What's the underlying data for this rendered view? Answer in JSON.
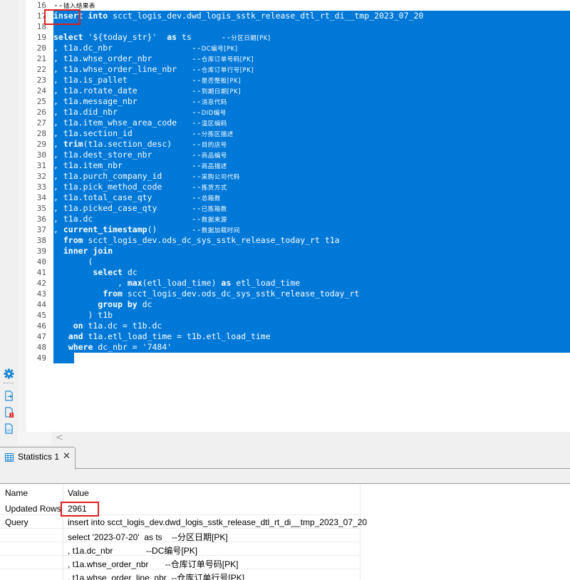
{
  "editor": {
    "lines": [
      {
        "num": "16",
        "selected": false,
        "code": "--",
        "comment": "插入结果表"
      },
      {
        "num": "17",
        "selected": true,
        "code": "insert into scct_logis_dev.dwd_logis_sstk_release_dtl_rt_di__tmp_2023_07_20",
        "comment": ""
      },
      {
        "num": "18",
        "selected": true,
        "code": "",
        "comment": ""
      },
      {
        "num": "19",
        "selected": true,
        "code": "select '${today_str}'  as ts      --",
        "comment": "分区日期[PK]"
      },
      {
        "num": "20",
        "selected": true,
        "code": ", t1a.dc_nbr                --",
        "comment": "DC编号[PK]"
      },
      {
        "num": "21",
        "selected": true,
        "code": ", t1a.whse_order_nbr        --",
        "comment": "仓库订单号码[PK]"
      },
      {
        "num": "22",
        "selected": true,
        "code": ", t1a.whse_order_line_nbr   --",
        "comment": "仓库订单行号[PK]"
      },
      {
        "num": "23",
        "selected": true,
        "code": ", t1a.is_pallet             --",
        "comment": "是否整板[PK]"
      },
      {
        "num": "24",
        "selected": true,
        "code": ", t1a.rotate_date           --",
        "comment": "到期日期[PK]"
      },
      {
        "num": "25",
        "selected": true,
        "code": ", t1a.message_nbr           --",
        "comment": "消息代码"
      },
      {
        "num": "26",
        "selected": true,
        "code": ", t1a.did_nbr               --",
        "comment": "DID编号"
      },
      {
        "num": "27",
        "selected": true,
        "code": ", t1a.item_whse_area_code   --",
        "comment": "温区编码"
      },
      {
        "num": "28",
        "selected": true,
        "code": ", t1a.section_id            --",
        "comment": "分拣区描述"
      },
      {
        "num": "29",
        "selected": true,
        "code": ", trim(t1a.section_desc)    --",
        "comment": "目的店号"
      },
      {
        "num": "30",
        "selected": true,
        "code": ", t1a.dest_store_nbr        --",
        "comment": "商品编号"
      },
      {
        "num": "31",
        "selected": true,
        "code": ", t1a.item_nbr              --",
        "comment": "商品描述"
      },
      {
        "num": "32",
        "selected": true,
        "code": ", t1a.purch_company_id      --",
        "comment": "采购公司代码"
      },
      {
        "num": "33",
        "selected": true,
        "code": ", t1a.pick_method_code      --",
        "comment": "拣货方式"
      },
      {
        "num": "34",
        "selected": true,
        "code": ", t1a.total_case_qty        --",
        "comment": "总箱数"
      },
      {
        "num": "35",
        "selected": true,
        "code": ", t1a.picked_case_qty       --",
        "comment": "已拣箱数"
      },
      {
        "num": "36",
        "selected": true,
        "code": ", t1a.dc                    --",
        "comment": "数据来源"
      },
      {
        "num": "37",
        "selected": true,
        "code": ", current_timestamp()       --",
        "comment": "数据加载时间"
      },
      {
        "num": "38",
        "selected": true,
        "code": "  from scct_logis_dev.ods_dc_sys_sstk_release_today_rt t1a",
        "comment": ""
      },
      {
        "num": "39",
        "selected": true,
        "code": "  inner join",
        "comment": ""
      },
      {
        "num": "40",
        "selected": true,
        "code": "       (",
        "comment": ""
      },
      {
        "num": "41",
        "selected": true,
        "code": "        select dc",
        "comment": ""
      },
      {
        "num": "42",
        "selected": true,
        "code": "             , max(etl_load_time) as etl_load_time",
        "comment": ""
      },
      {
        "num": "43",
        "selected": true,
        "code": "          from scct_logis_dev.ods_dc_sys_sstk_release_today_rt",
        "comment": ""
      },
      {
        "num": "44",
        "selected": true,
        "code": "         group by dc",
        "comment": ""
      },
      {
        "num": "45",
        "selected": true,
        "code": "       ) t1b",
        "comment": ""
      },
      {
        "num": "46",
        "selected": true,
        "code": "    on t1a.dc = t1b.dc",
        "comment": ""
      },
      {
        "num": "47",
        "selected": true,
        "code": "   and t1a.etl_load_time = t1b.etl_load_time",
        "comment": ""
      },
      {
        "num": "48",
        "selected": true,
        "code": "   where dc_nbr = '7484'",
        "comment": ""
      },
      {
        "num": "49",
        "selected": true,
        "code": "    ;",
        "comment": ""
      }
    ],
    "selection_color": "#0078d7",
    "highlight_color": "#e02020"
  },
  "left_rail": {
    "icons": [
      "gear-icon",
      "export-file-icon",
      "file-error-icon",
      "file-variable-icon"
    ]
  },
  "scrollbar": {
    "left_arrow": "<"
  },
  "results": {
    "tab_label": "Statistics 1",
    "tab_close": "✕",
    "columns": [
      "Name",
      "Value"
    ],
    "rows": [
      {
        "name": "Updated Rows",
        "value": "2961"
      },
      {
        "name": "Query",
        "value": "insert into scct_logis_dev.dwd_logis_sstk_release_dtl_rt_di__tmp_2023_07_20"
      },
      {
        "name": "",
        "value": "select '2023-07-20'  as ts    --分区日期[PK]"
      },
      {
        "name": "",
        "value": ", t1a.dc_nbr              --DC编号[PK]"
      },
      {
        "name": "",
        "value": ", t1a.whse_order_nbr       --仓库订单号码[PK]"
      },
      {
        "name": "",
        "value": ", t1a.whse_order_line_nbr  --仓库订单行号[PK]"
      }
    ]
  }
}
